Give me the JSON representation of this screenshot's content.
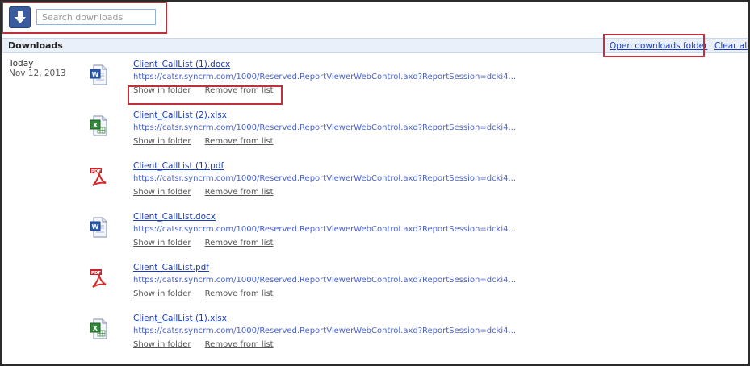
{
  "search": {
    "placeholder": "Search downloads"
  },
  "header": {
    "title": "Downloads",
    "open_folder": "Open downloads folder",
    "clear_all": "Clear all"
  },
  "date_group": {
    "label": "Today",
    "date": "Nov 12, 2013"
  },
  "actions": {
    "show_in_folder": "Show in folder",
    "remove_from_list": "Remove from list"
  },
  "downloads": [
    {
      "name": "Client_CallList (1).docx",
      "url": "https://catsr.syncrm.com/1000/Reserved.ReportViewerWebControl.axd?ReportSession=dcki4...",
      "type_icon": "word-doc-icon"
    },
    {
      "name": "Client_CallList (2).xlsx",
      "url": "https://catsr.syncrm.com/1000/Reserved.ReportViewerWebControl.axd?ReportSession=dcki4...",
      "type_icon": "excel-xlsx-icon"
    },
    {
      "name": "Client_CallList (1).pdf",
      "url": "https://catsr.syncrm.com/1000/Reserved.ReportViewerWebControl.axd?ReportSession=dcki4...",
      "type_icon": "pdf-icon"
    },
    {
      "name": "Client_CallList.docx",
      "url": "https://catsr.syncrm.com/1000/Reserved.ReportViewerWebControl.axd?ReportSession=dcki4...",
      "type_icon": "word-doc-icon"
    },
    {
      "name": "Client_CallList.pdf",
      "url": "https://catsr.syncrm.com/1000/Reserved.ReportViewerWebControl.axd?ReportSession=dcki4...",
      "type_icon": "pdf-icon"
    },
    {
      "name": "Client_CallList (1).xlsx",
      "url": "https://catsr.syncrm.com/1000/Reserved.ReportViewerWebControl.axd?ReportSession=dcki4...",
      "type_icon": "excel-xlsx-icon"
    }
  ],
  "colors": {
    "link": "#1a3bb8",
    "url": "#4b63c8",
    "highlight": "#c0303a",
    "header_bg": "#eaf0fa",
    "button": "#3a5b9c"
  }
}
